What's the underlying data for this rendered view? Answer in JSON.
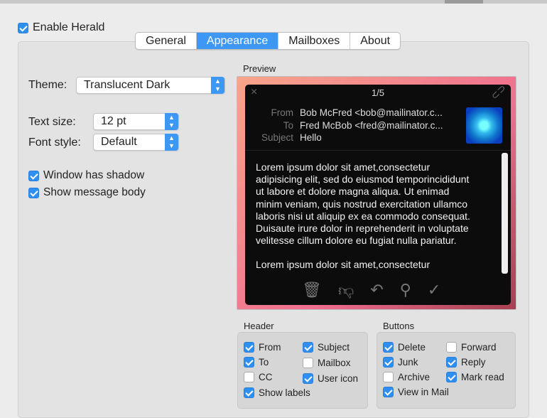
{
  "enable_herald": {
    "label": "Enable Herald",
    "checked": true
  },
  "tabs": [
    {
      "label": "General",
      "active": false
    },
    {
      "label": "Appearance",
      "active": true
    },
    {
      "label": "Mailboxes",
      "active": false
    },
    {
      "label": "About",
      "active": false
    }
  ],
  "theme": {
    "label": "Theme:",
    "value": "Translucent Dark"
  },
  "text_size": {
    "label": "Text size:",
    "value": "12 pt"
  },
  "font_style": {
    "label": "Font style:",
    "value": "Default"
  },
  "options": [
    {
      "label": "Window has shadow",
      "checked": true
    },
    {
      "label": "Show message body",
      "checked": true
    }
  ],
  "preview": {
    "label": "Preview",
    "counter": "1/5",
    "from_label": "From",
    "from": "Bob McFred <bob@mailinator.c...",
    "to_label": "To",
    "to": "Fred McBob <fred@mailinator.c...",
    "subject_label": "Subject",
    "subject": "Hello",
    "body": [
      "Lorem ipsum dolor sit amet,consectetur",
      "adipisicing elit, sed do eiusmod temporincididunt",
      "ut labore et dolore magna aliqua. Ut enimad",
      "minim veniam, quis nostrud exercitation ullamco",
      "laboris nisi ut aliquip ex ea commodo consequat.",
      "Duisaute irure dolor in reprehenderit in voluptate",
      "velitesse cillum dolore eu fugiat nulla pariatur.",
      "",
      "Lorem ipsum dolor sit amet,consectetur"
    ]
  },
  "header_group": {
    "label": "Header",
    "items": [
      {
        "label": "From",
        "checked": true
      },
      {
        "label": "Subject",
        "checked": true
      },
      {
        "label": "To",
        "checked": true
      },
      {
        "label": "Mailbox",
        "checked": false
      },
      {
        "label": "CC",
        "checked": false
      },
      {
        "label": "User icon",
        "checked": true
      },
      {
        "label": "Show labels",
        "checked": true
      }
    ]
  },
  "buttons_group": {
    "label": "Buttons",
    "items": [
      {
        "label": "Delete",
        "checked": true
      },
      {
        "label": "Forward",
        "checked": false
      },
      {
        "label": "Junk",
        "checked": true
      },
      {
        "label": "Reply",
        "checked": true
      },
      {
        "label": "Archive",
        "checked": false
      },
      {
        "label": "Mark read",
        "checked": true
      },
      {
        "label": "View in Mail",
        "checked": true
      }
    ]
  },
  "accent": "#3d97f5"
}
